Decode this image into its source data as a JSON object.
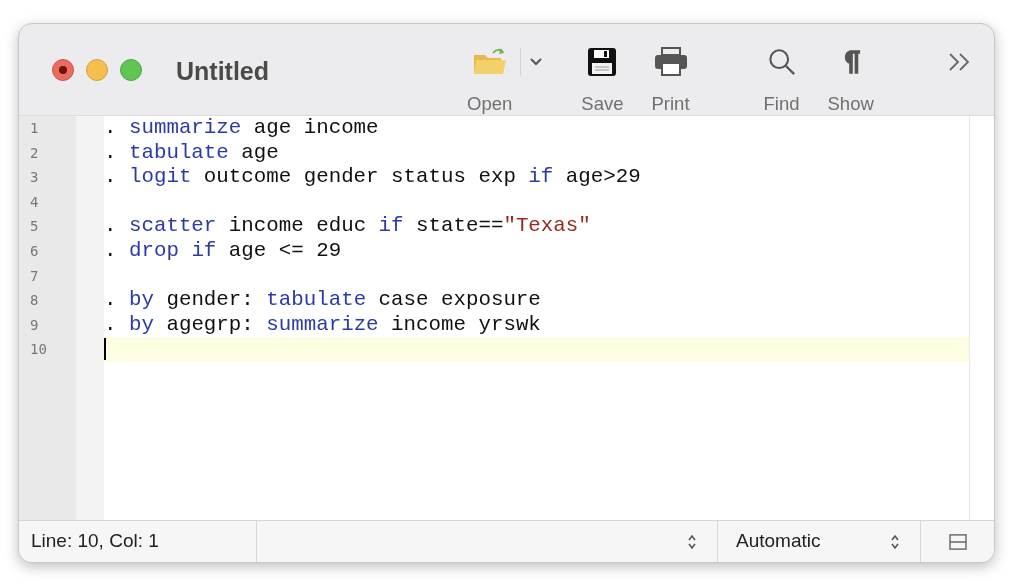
{
  "window": {
    "title": "Untitled",
    "unsaved": true
  },
  "toolbar": [
    {
      "kind": "open",
      "label": "Open"
    },
    {
      "kind": "save",
      "label": "Save"
    },
    {
      "kind": "print",
      "label": "Print"
    },
    {
      "kind": "find",
      "label": "Find"
    },
    {
      "kind": "show",
      "label": "Show"
    }
  ],
  "editor": {
    "lines": [
      {
        "number": "1",
        "selected": false,
        "tokens": [
          {
            "text": ". ",
            "kind": "plain"
          },
          {
            "text": "summarize",
            "kind": "keyword"
          },
          {
            "text": " age income",
            "kind": "plain"
          }
        ]
      },
      {
        "number": "2",
        "selected": false,
        "tokens": [
          {
            "text": ". ",
            "kind": "plain"
          },
          {
            "text": "tabulate",
            "kind": "keyword"
          },
          {
            "text": " age",
            "kind": "plain"
          }
        ]
      },
      {
        "number": "3",
        "selected": false,
        "tokens": [
          {
            "text": ". ",
            "kind": "plain"
          },
          {
            "text": "logit",
            "kind": "keyword"
          },
          {
            "text": " outcome gender status exp ",
            "kind": "plain"
          },
          {
            "text": "if",
            "kind": "keyword"
          },
          {
            "text": " age>29",
            "kind": "plain"
          }
        ]
      },
      {
        "number": "4",
        "selected": false
      },
      {
        "number": "5",
        "selected": false,
        "tokens": [
          {
            "text": ". ",
            "kind": "plain"
          },
          {
            "text": "scatter",
            "kind": "keyword"
          },
          {
            "text": " income educ ",
            "kind": "plain"
          },
          {
            "text": "if",
            "kind": "keyword"
          },
          {
            "text": " state==",
            "kind": "plain"
          },
          {
            "text": "\"Texas\"",
            "kind": "string"
          }
        ]
      },
      {
        "number": "6",
        "selected": false,
        "tokens": [
          {
            "text": ". ",
            "kind": "plain"
          },
          {
            "text": "drop ",
            "kind": "keyword"
          },
          {
            "text": "if",
            "kind": "keyword"
          },
          {
            "text": " age <= 29",
            "kind": "plain"
          }
        ]
      },
      {
        "number": "7",
        "selected": false
      },
      {
        "number": "8",
        "selected": false,
        "tokens": [
          {
            "text": ". ",
            "kind": "plain"
          },
          {
            "text": "by",
            "kind": "keyword"
          },
          {
            "text": " gender: ",
            "kind": "plain"
          },
          {
            "text": "tabulate",
            "kind": "keyword"
          },
          {
            "text": " case exposure",
            "kind": "plain"
          }
        ]
      },
      {
        "number": "9",
        "selected": false,
        "tokens": [
          {
            "text": ". ",
            "kind": "plain"
          },
          {
            "text": "by",
            "kind": "keyword"
          },
          {
            "text": " agegrp: ",
            "kind": "plain"
          },
          {
            "text": "summarize",
            "kind": "keyword"
          },
          {
            "text": " income yrswk",
            "kind": "plain"
          }
        ]
      },
      {
        "number": "10",
        "selected": true
      }
    ]
  },
  "status_bar": {
    "position": "Line: 10, Col: 1",
    "mode": "Automatic"
  }
}
